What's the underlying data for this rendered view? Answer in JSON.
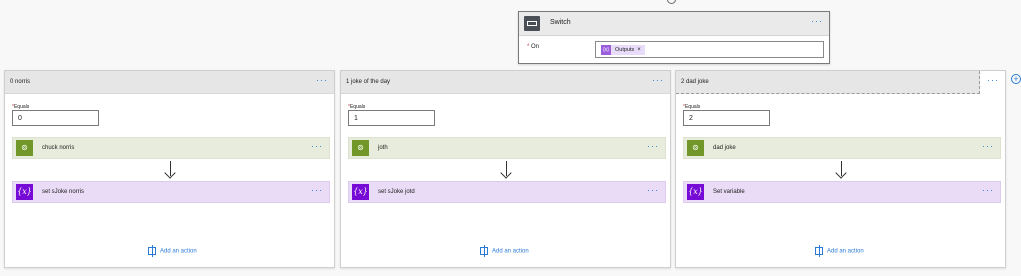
{
  "switch": {
    "title": "Switch",
    "on_label": "On",
    "required_mark": "*",
    "token_label": "Outputs",
    "token_icon": "{x}",
    "token_remove": "×",
    "more": "···"
  },
  "cases": [
    {
      "title": "0 norris",
      "equals_label": "Equals",
      "equals_value": "0",
      "http_action": "chuck norris",
      "var_action": "set sJoke norris",
      "add_action": "Add an action",
      "more": "···"
    },
    {
      "title": "1 joke of the day",
      "equals_label": "Equals",
      "equals_value": "1",
      "http_action": "joth",
      "var_action": "set sJoke jotd",
      "add_action": "Add an action",
      "more": "···"
    },
    {
      "title": "2 dad joke",
      "equals_label": "Equals",
      "equals_value": "2",
      "http_action": "dad joke",
      "var_action": "Set variable",
      "add_action": "Add an action",
      "more": "···"
    }
  ],
  "icons": {
    "http": "globe-icon",
    "variable": "variable-icon",
    "switch": "switch-icon",
    "add": "add-action-icon",
    "plus": "add-case-icon"
  },
  "colors": {
    "http_bg": "#e7ecdc",
    "http_icon": "#709727",
    "var_bg": "#eadcf6",
    "var_icon": "#770bd6",
    "link": "#2a7bd8"
  }
}
